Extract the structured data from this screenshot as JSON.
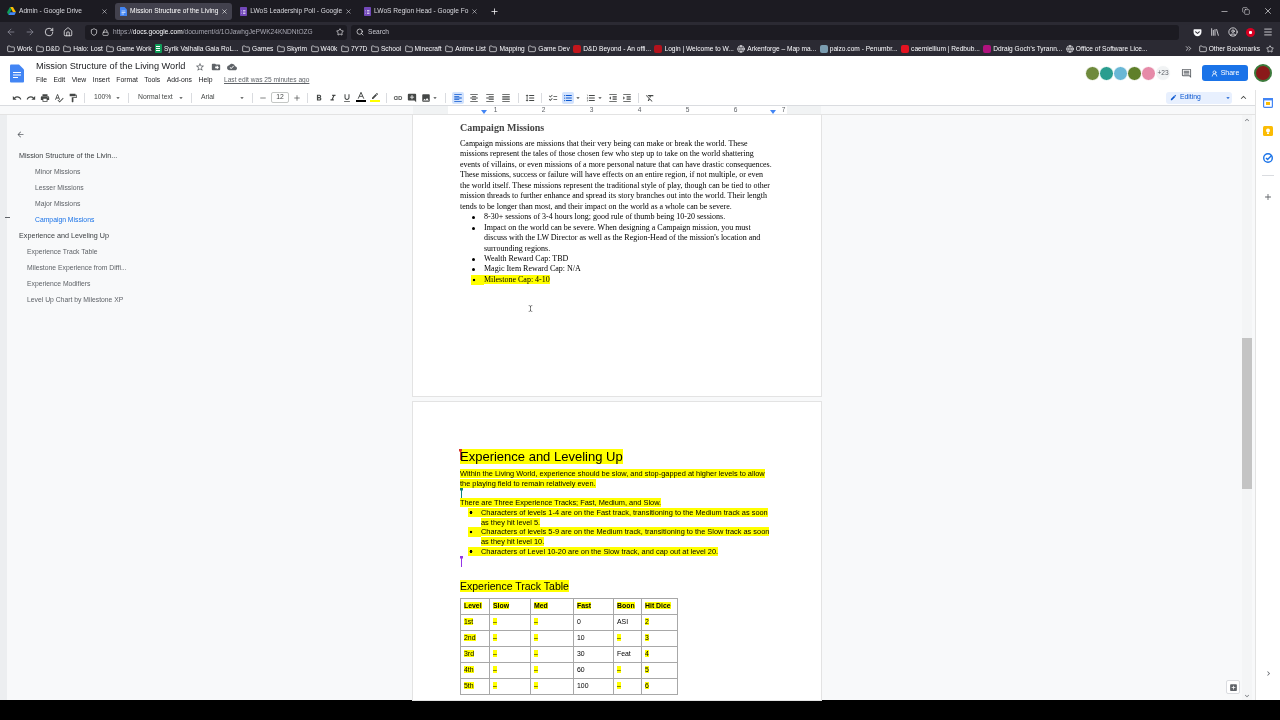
{
  "browser": {
    "tabs": [
      {
        "kind": "drive",
        "title": "Admin - Google Drive",
        "selected": false
      },
      {
        "kind": "docs",
        "title": "Mission Structure of the Living",
        "selected": true
      },
      {
        "kind": "forms",
        "title": "LWoS Leadership Poll - Google",
        "selected": false
      },
      {
        "kind": "forms",
        "title": "LWoS Region Head - Google Fo",
        "selected": false
      }
    ],
    "address": "https://**docs.google.com**/document/d/1OJawhgJePWK24KNDNtOZG",
    "search": {
      "placeholder": "Search"
    },
    "bookmarks": [
      {
        "kind": "folder",
        "label": "Work"
      },
      {
        "kind": "folder",
        "label": "D&D"
      },
      {
        "kind": "folder",
        "label": "Halo: Lost"
      },
      {
        "kind": "folder",
        "label": "Game Work"
      },
      {
        "kind": "sheet",
        "label": "Syrik Valhalla Gaia RoL...",
        "color": "#0f9d58"
      },
      {
        "kind": "folder",
        "label": "Games"
      },
      {
        "kind": "folder",
        "label": "Skyrim"
      },
      {
        "kind": "folder",
        "label": "W40k"
      },
      {
        "kind": "folder",
        "label": "7Y7D"
      },
      {
        "kind": "folder",
        "label": "School"
      },
      {
        "kind": "folder",
        "label": "Minecraft"
      },
      {
        "kind": "folder",
        "label": "Anime List"
      },
      {
        "kind": "folder",
        "label": "Mapping"
      },
      {
        "kind": "folder",
        "label": "Game Dev"
      },
      {
        "kind": "site",
        "label": "D&D Beyond - An offi...",
        "color": "#c3161c"
      },
      {
        "kind": "site",
        "label": "Login | Welcome to W...",
        "color": "#b3121c"
      },
      {
        "kind": "globe",
        "label": "Arkenforge – Map ma..."
      },
      {
        "kind": "site",
        "label": "paizo.com - Penumbr...",
        "color": "#7a9cb0"
      },
      {
        "kind": "site",
        "label": "caemiellium | Redbub...",
        "color": "#e41321"
      },
      {
        "kind": "site",
        "label": "Ddraig Goch's Tyrann...",
        "color": "#b0127e"
      },
      {
        "kind": "globe",
        "label": "Office of Software Lice..."
      }
    ],
    "other_bookmarks": "Other Bookmarks"
  },
  "docs": {
    "title": "Mission Structure of the Living World",
    "menu": [
      "File",
      "Edit",
      "View",
      "Insert",
      "Format",
      "Tools",
      "Add-ons",
      "Help"
    ],
    "last_edit": "Last edit was 25 minutes ago",
    "collaborators": [
      {
        "color": "#6f8a3c"
      },
      {
        "color": "#2a9d8f"
      },
      {
        "color": "#69b7d6"
      },
      {
        "color": "#5f7f2a"
      },
      {
        "color": "#e68aa8"
      }
    ],
    "more_collaborators": "+23",
    "share": "Share"
  },
  "toolbar": {
    "zoom": "100%",
    "style": "Normal text",
    "font": "Arial",
    "font_size": "12",
    "align_buttons": [
      {
        "selected": true
      },
      {
        "selected": false
      },
      {
        "selected": false
      },
      {
        "selected": false
      }
    ],
    "bulleted_list": true,
    "mode": "Editing"
  },
  "outline": {
    "items": [
      {
        "label": "Mission Structure of the Livin...",
        "selected": false,
        "children": [
          {
            "kind": "h3",
            "label": "Minor Missions",
            "selected": false
          },
          {
            "kind": "h3",
            "label": "Lesser Missions",
            "selected": false
          },
          {
            "kind": "h3",
            "label": "Major Missions",
            "selected": false
          },
          {
            "kind": "h3",
            "label": "Campaign Missions",
            "selected": true
          }
        ]
      },
      {
        "label": "Experience and Leveling Up",
        "selected": false,
        "children": [
          {
            "kind": "h2",
            "label": "Experience Track Table",
            "selected": false
          },
          {
            "kind": "h2",
            "label": "Milestone Experience from Diffi...",
            "selected": false
          },
          {
            "kind": "h2",
            "label": "Experience Modifiers",
            "selected": false
          },
          {
            "kind": "h2",
            "label": "Level Up Chart by Milestone XP",
            "selected": false
          }
        ]
      }
    ]
  },
  "ruler": {
    "numbers": [
      "1",
      "2",
      "3",
      "4",
      "5",
      "6",
      "7"
    ]
  },
  "page_1": {
    "heading": "Campaign Missions",
    "paragraph": "Campaign missions are missions that their very being can make or break the world. These missions represent the tales of those chosen few who step up to take on the world shattering events of villains, or even missions of a more personal nature that can have drastic consequences. These missions, success or failure will have effects on an entire region, if not multiple, or even the world itself. These missions represent the traditional style of play, though can be tied to other mission threads to further enhance and spread its story branches out into the world. Their length tends to be longer than most, and their impact on the world as a whole can be severe.",
    "bullets": [
      {
        "text": "8-30+ sessions of 3-4 hours long; good rule of thumb being 10-20 sessions.",
        "highlighted": false
      },
      {
        "text": "Impact on the world can be severe. When designing a Campaign mission, you must discuss with the LW Director as well as the Region-Head of the mission's location and surrounding regions.",
        "highlighted": false
      },
      {
        "text": "Wealth Reward Cap: TBD",
        "highlighted": false
      },
      {
        "text": "Magic Item Reward Cap: N/A",
        "highlighted": false
      },
      {
        "text": "Milestone Cap: 4-10",
        "highlighted": true
      }
    ]
  },
  "page_2": {
    "blocks": [
      {
        "kind": "heading",
        "text": "Experience and Leveling Up",
        "highlighted": true,
        "cursor": {
          "color": "#d93025"
        }
      },
      {
        "kind": "paragraph",
        "text": "Within the Living World, experience should be slow, and stop-gapped at higher levels to allow the playing field to remain relatively even.",
        "highlighted": true
      },
      {
        "kind": "cursor",
        "color": "#12837a"
      },
      {
        "kind": "paragraph",
        "text": "There are Three Experience Tracks; Fast, Medium, and Slow.",
        "highlighted": true
      },
      {
        "kind": "bullets",
        "items": [
          {
            "text": "Characters of levels 1-4 are on the Fast track, transitioning to the Medium track as soon as they hit level 5.",
            "highlighted": true
          },
          {
            "text": "Characters of levels 5-9 are on the Medium track, transitioning to the Slow track as soon as they hit level 10.",
            "highlighted": true
          },
          {
            "text": "Characters of Level 10-20 are on the Slow track, and cap out at level 20.",
            "highlighted": true
          }
        ]
      },
      {
        "kind": "cursor",
        "color": "#9334e6"
      },
      {
        "kind": "subheading",
        "text": "Experience Track Table",
        "highlighted": true
      },
      {
        "kind": "table",
        "columns": [
          {
            "text": "Level",
            "highlighted": true
          },
          {
            "text": "Slow",
            "highlighted": true
          },
          {
            "text": "Med",
            "highlighted": true
          },
          {
            "text": "Fast",
            "highlighted": true
          },
          {
            "text": "Boon",
            "highlighted": true
          },
          {
            "text": "Hit Dice",
            "highlighted": true
          }
        ],
        "rows": [
          [
            {
              "text": "1st",
              "highlighted": true
            },
            {
              "text": "–",
              "highlighted": true
            },
            {
              "text": "–",
              "highlighted": true
            },
            {
              "text": "0",
              "highlighted": false
            },
            {
              "text": "ASI",
              "highlighted": false
            },
            {
              "text": "2",
              "highlighted": true
            }
          ],
          [
            {
              "text": "2nd",
              "highlighted": true
            },
            {
              "text": "–",
              "highlighted": true
            },
            {
              "text": "–",
              "highlighted": true
            },
            {
              "text": "10",
              "highlighted": false
            },
            {
              "text": "–",
              "highlighted": true
            },
            {
              "text": "3",
              "highlighted": true
            }
          ],
          [
            {
              "text": "3rd",
              "highlighted": true
            },
            {
              "text": "–",
              "highlighted": true
            },
            {
              "text": "–",
              "highlighted": true
            },
            {
              "text": "30",
              "highlighted": false
            },
            {
              "text": "Feat",
              "highlighted": false
            },
            {
              "text": "4",
              "highlighted": true
            }
          ],
          [
            {
              "text": "4th",
              "highlighted": true
            },
            {
              "text": "–",
              "highlighted": true
            },
            {
              "text": "–",
              "highlighted": true
            },
            {
              "text": "60",
              "highlighted": false
            },
            {
              "text": "–",
              "highlighted": true
            },
            {
              "text": "5",
              "highlighted": true
            }
          ],
          [
            {
              "text": "5th",
              "highlighted": true
            },
            {
              "text": "–",
              "highlighted": true
            },
            {
              "text": "–",
              "highlighted": true
            },
            {
              "text": "100",
              "highlighted": false
            },
            {
              "text": "–",
              "highlighted": true
            },
            {
              "text": "6",
              "highlighted": true
            }
          ]
        ]
      }
    ]
  }
}
